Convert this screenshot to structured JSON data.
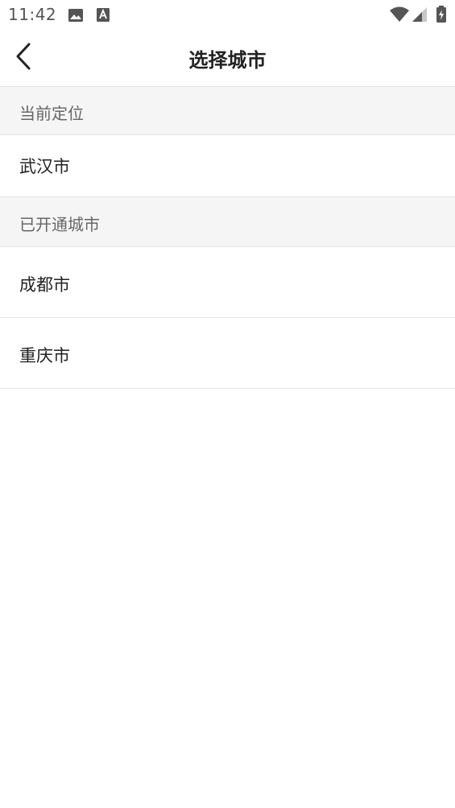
{
  "status_bar": {
    "time": "11:42",
    "icons": [
      "image-icon",
      "a-notification-icon",
      "wifi-icon",
      "signal-icon",
      "battery-charging-icon"
    ]
  },
  "nav": {
    "title": "选择城市",
    "back_icon": "chevron-left-icon"
  },
  "sections": {
    "current_location": {
      "header": "当前定位",
      "city": "武汉市"
    },
    "opened_cities": {
      "header": "已开通城市",
      "cities": [
        "成都市",
        "重庆市"
      ]
    }
  },
  "colors": {
    "section_background": "#f5f5f5",
    "divider": "#e6e6e6",
    "text_primary": "#222222",
    "text_secondary": "#666666"
  }
}
